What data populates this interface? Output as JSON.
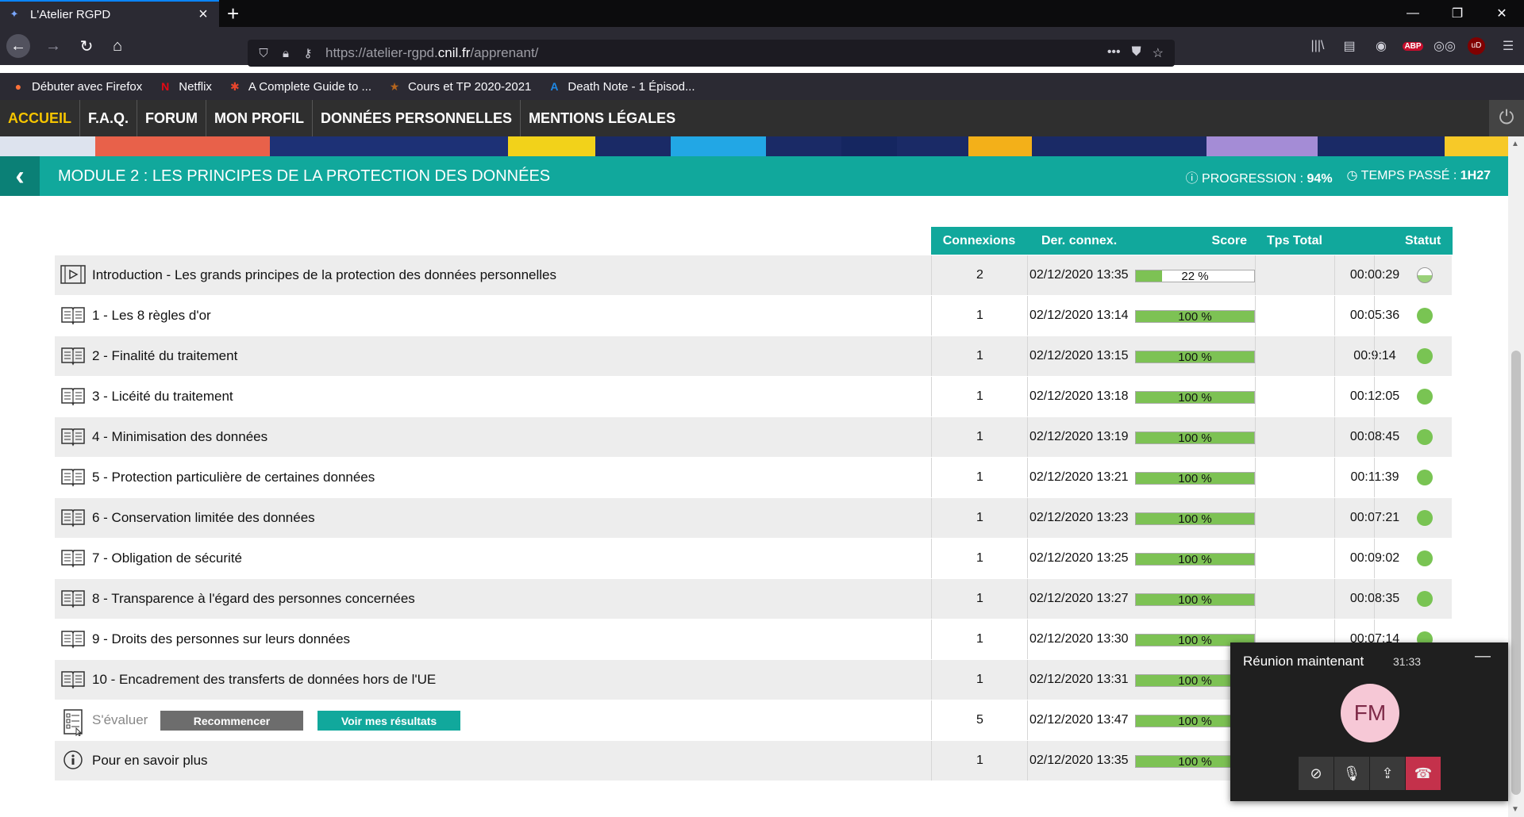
{
  "browser": {
    "tab_title": "L'Atelier RGPD",
    "url_prefix": "https://atelier-rgpd.",
    "url_domain": "cnil.fr",
    "url_path": "/apprenant/",
    "bookmarks": [
      "Débuter avec Firefox",
      "Netflix",
      "A Complete Guide to ...",
      "Cours et TP 2020-2021",
      "Death Note - 1 Épisod..."
    ],
    "ext_abp": "ABP",
    "ext_ublock": "uD"
  },
  "sitenav": {
    "items": [
      "ACCUEIL",
      "F.A.Q.",
      "FORUM",
      "MON PROFIL",
      "DONNÉES PERSONNELLES",
      "MENTIONS LÉGALES"
    ]
  },
  "module": {
    "title": "MODULE 2 : LES PRINCIPES DE LA PROTECTION DES DONNÉES",
    "progression_label": "PROGRESSION :",
    "progression_value": "94%",
    "time_label": "TEMPS PASSÉ :",
    "time_value": "1H27"
  },
  "table": {
    "headers": [
      "Connexions",
      "Der. connex.",
      "Score",
      "Tps Total",
      "Statut"
    ],
    "rows": [
      {
        "label": "Introduction - Les grands principes de la protection des données personnelles",
        "icon": "video-icon",
        "connexions": "2",
        "date": "02/12/2020 13:35",
        "progress": 22,
        "progress_label": "22 %",
        "tps": "00:00:29",
        "status": "partial"
      },
      {
        "label": "1 - Les 8 règles d'or",
        "icon": "book-icon",
        "connexions": "1",
        "date": "02/12/2020 13:14",
        "progress": 100,
        "progress_label": "100 %",
        "tps": "00:05:36",
        "status": "done"
      },
      {
        "label": "2 - Finalité du traitement",
        "icon": "book-icon",
        "connexions": "1",
        "date": "02/12/2020 13:15",
        "progress": 100,
        "progress_label": "100 %",
        "tps": "00:9:14",
        "status": "done"
      },
      {
        "label": "3 - Licéité du traitement",
        "icon": "book-icon",
        "connexions": "1",
        "date": "02/12/2020 13:18",
        "progress": 100,
        "progress_label": "100 %",
        "tps": "00:12:05",
        "status": "done"
      },
      {
        "label": "4 - Minimisation des données",
        "icon": "book-icon",
        "connexions": "1",
        "date": "02/12/2020 13:19",
        "progress": 100,
        "progress_label": "100 %",
        "tps": "00:08:45",
        "status": "done"
      },
      {
        "label": "5 - Protection particulière de certaines données",
        "icon": "book-icon",
        "connexions": "1",
        "date": "02/12/2020 13:21",
        "progress": 100,
        "progress_label": "100 %",
        "tps": "00:11:39",
        "status": "done"
      },
      {
        "label": "6 - Conservation limitée des données",
        "icon": "book-icon",
        "connexions": "1",
        "date": "02/12/2020 13:23",
        "progress": 100,
        "progress_label": "100 %",
        "tps": "00:07:21",
        "status": "done"
      },
      {
        "label": "7 - Obligation de sécurité",
        "icon": "book-icon",
        "connexions": "1",
        "date": "02/12/2020 13:25",
        "progress": 100,
        "progress_label": "100 %",
        "tps": "00:09:02",
        "status": "done"
      },
      {
        "label": "8 - Transparence à l'égard des personnes concernées",
        "icon": "book-icon",
        "connexions": "1",
        "date": "02/12/2020 13:27",
        "progress": 100,
        "progress_label": "100 %",
        "tps": "00:08:35",
        "status": "done"
      },
      {
        "label": "9 - Droits des personnes sur leurs données",
        "icon": "book-icon",
        "connexions": "1",
        "date": "02/12/2020 13:30",
        "progress": 100,
        "progress_label": "100 %",
        "tps": "00:07:14",
        "status": "done"
      },
      {
        "label": "10 - Encadrement des transferts de données hors de l'UE",
        "icon": "book-icon",
        "connexions": "1",
        "date": "02/12/2020 13:31",
        "progress": 100,
        "progress_label": "100 %",
        "tps": "",
        "status": "hidden"
      },
      {
        "label": "S'évaluer",
        "icon": "quiz-icon",
        "connexions": "5",
        "date": "02/12/2020 13:47",
        "progress": 100,
        "progress_label": "100 %",
        "tps": "",
        "status": "hidden",
        "buttons": [
          "Recommencer",
          "Voir mes résultats"
        ]
      },
      {
        "label": "Pour en savoir plus",
        "icon": "info-icon",
        "connexions": "1",
        "date": "02/12/2020 13:35",
        "progress": 100,
        "progress_label": "100 %",
        "tps": "",
        "status": "hidden"
      }
    ]
  },
  "meeting": {
    "title": "Réunion maintenant",
    "time": "31:33",
    "initials": "FM"
  },
  "colors": {
    "teal": "#11a89c",
    "green": "#7dc254",
    "nav": "#2f2f2f",
    "active_nav": "#f5c400"
  }
}
